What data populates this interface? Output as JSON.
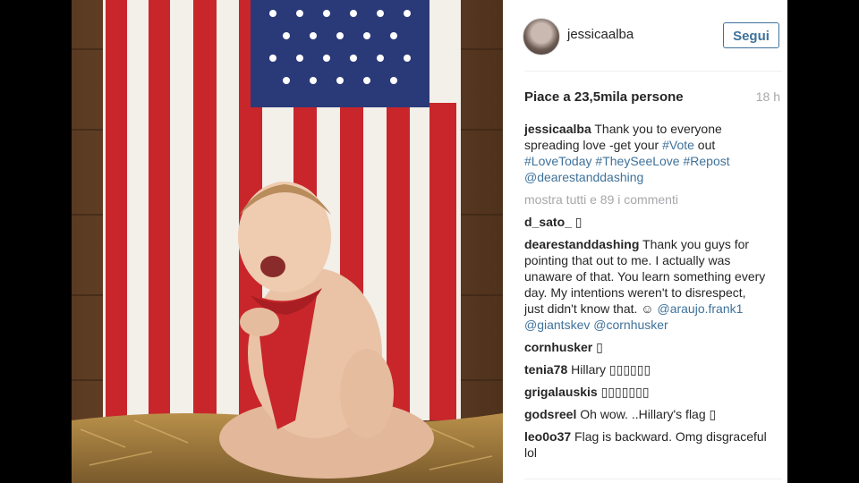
{
  "post": {
    "username": "jessicaalba",
    "follow_label": "Segui",
    "likes_text": "Piace a 23,5mila persone",
    "time": "18 h",
    "caption": {
      "text_1": "Thank you to everyone spreading love -get your ",
      "tag_vote": "#Vote",
      "text_2": " out ",
      "tag_love": "#LoveToday",
      "tag_see": "#TheySeeLove",
      "tag_repost": "#Repost",
      "mention": "@dearestanddashing"
    },
    "show_all_label": "mostra tutti e 89 i commenti"
  },
  "comments": [
    {
      "user": "d_sato_",
      "text": " ▯"
    },
    {
      "user": "dearestanddashing",
      "text": "Thank you guys for pointing that out to me. I actually was unaware of that. You learn something every day. My intentions weren't to disrespect, just didn't know that. ☺",
      "mention_1": "@araujo.frank1",
      "mention_2": "@giantskev",
      "mention_3": "@cornhusker"
    },
    {
      "user": "cornhusker",
      "text": " ▯"
    },
    {
      "user": "tenia78",
      "text": "Hillary ▯▯▯▯▯▯"
    },
    {
      "user": "grigalauskis",
      "text": "▯▯▯▯▯▯▯"
    },
    {
      "user": "godsreel",
      "text": "Oh wow. ..Hillary's flag ▯"
    },
    {
      "user": "leo0o37",
      "text": "Flag is backward. Omg disgraceful lol"
    }
  ],
  "colors": {
    "link": "#3f729b",
    "muted": "#a5a7aa",
    "text": "#262626"
  }
}
